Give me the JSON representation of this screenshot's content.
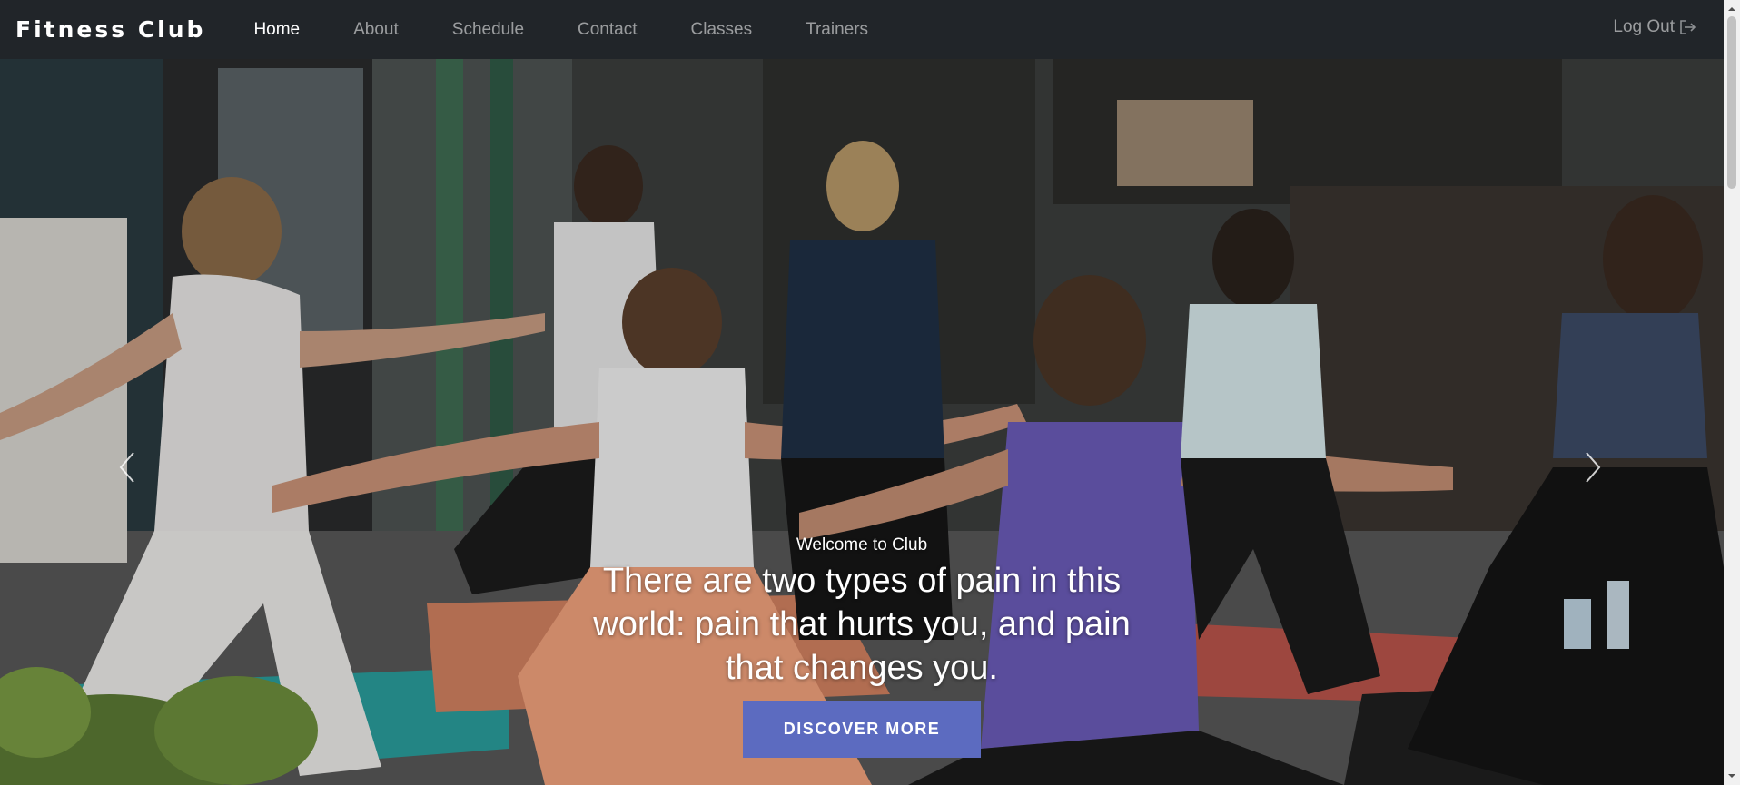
{
  "navbar": {
    "brand": "Fitness Club",
    "links": [
      {
        "label": "Home",
        "active": true
      },
      {
        "label": "About",
        "active": false
      },
      {
        "label": "Schedule",
        "active": false
      },
      {
        "label": "Contact",
        "active": false
      },
      {
        "label": "Classes",
        "active": false
      },
      {
        "label": "Trainers",
        "active": false
      }
    ],
    "logout_label": "Log Out",
    "logout_icon": "logout-icon"
  },
  "hero": {
    "welcome": "Welcome to Club",
    "quote": "There are two types of pain in this world: pain that hurts you, and pain that changes you.",
    "button_label": "DISCOVER MORE",
    "prev_icon": "chevron-left-icon",
    "next_icon": "chevron-right-icon",
    "image_description_icon": "yoga-class-photo"
  },
  "colors": {
    "navbar_bg": "#212529",
    "accent": "#5c6bc0",
    "active_link": "#ffffff",
    "inactive_link": "#8c8f92"
  }
}
